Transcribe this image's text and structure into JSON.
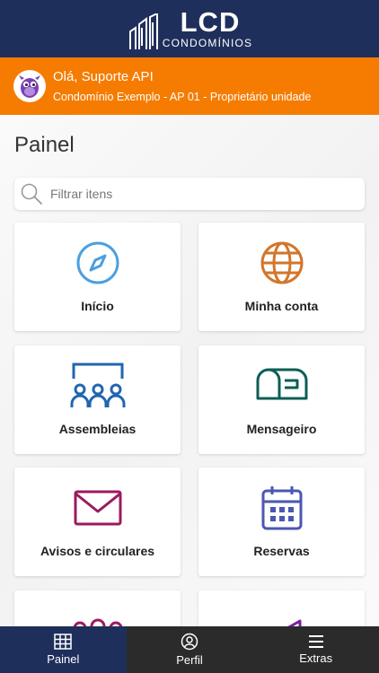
{
  "header": {
    "logo_title": "LCD",
    "logo_subtitle": "CONDOMÍNIOS"
  },
  "user": {
    "greeting": "Olá, Suporte API",
    "details": "Condomínio Exemplo - AP 01 - Proprietário unidade"
  },
  "page": {
    "title": "Painel"
  },
  "search": {
    "placeholder": "Filtrar itens"
  },
  "cards": [
    {
      "label": "Início",
      "icon": "compass-icon",
      "color": "#4a9fe0"
    },
    {
      "label": "Minha conta",
      "icon": "globe-icon",
      "color": "#d2762b"
    },
    {
      "label": "Assembleias",
      "icon": "assembly-icon",
      "color": "#2166b0"
    },
    {
      "label": "Mensageiro",
      "icon": "mailbox-icon",
      "color": "#0d5e55"
    },
    {
      "label": "Avisos e circulares",
      "icon": "envelope-icon",
      "color": "#9c1a5e"
    },
    {
      "label": "Reservas",
      "icon": "calendar-icon",
      "color": "#4b57b0"
    }
  ],
  "partial_cards": [
    {
      "icon": "group-icon",
      "color": "#9c1a5e"
    },
    {
      "icon": "megaphone-icon",
      "color": "#7a1fa2"
    }
  ],
  "bottom_nav": [
    {
      "label": "Painel",
      "icon": "grid-icon",
      "active": true
    },
    {
      "label": "Perfil",
      "icon": "user-circle-icon",
      "active": false
    },
    {
      "label": "Extras",
      "icon": "menu-icon",
      "active": false
    }
  ],
  "colors": {
    "header_bg": "#1f2f5b",
    "userbar_bg": "#f57c00",
    "nav_bg": "#2b2b2b",
    "nav_active_bg": "#1f2f5b"
  }
}
